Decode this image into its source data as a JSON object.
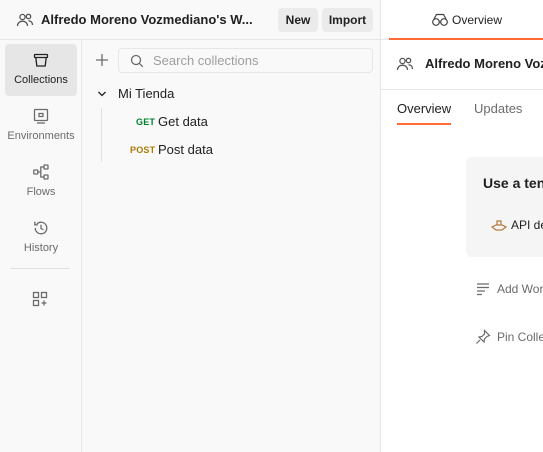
{
  "workspace": {
    "title": "Alfredo Moreno Vozmediano's W...",
    "new_label": "New",
    "import_label": "Import"
  },
  "sidebar": {
    "items": [
      {
        "label": "Collections",
        "icon": "collections-icon",
        "active": true
      },
      {
        "label": "Environments",
        "icon": "environments-icon",
        "active": false
      },
      {
        "label": "Flows",
        "icon": "flows-icon",
        "active": false
      },
      {
        "label": "History",
        "icon": "history-icon",
        "active": false
      }
    ],
    "extra_icon": "configure-sidebar-icon"
  },
  "collections": {
    "search_placeholder": "Search collections",
    "search_value": "",
    "tree": {
      "name": "Mi Tienda",
      "expanded": true,
      "requests": [
        {
          "method": "GET",
          "name": "Get data",
          "method_color": "#007f31"
        },
        {
          "method": "POST",
          "name": "Post data",
          "method_color": "#ad7a03"
        }
      ]
    }
  },
  "right": {
    "top_tab_label": "Overview",
    "workspace_title": "Alfredo Moreno Vozr",
    "tabs": [
      {
        "label": "Overview",
        "active": true
      },
      {
        "label": "Updates",
        "active": false
      }
    ],
    "card": {
      "title": "Use a ten",
      "item_label": "API de"
    },
    "actions": [
      {
        "label": "Add Wor",
        "icon": "description-icon"
      },
      {
        "label": "Pin Colle",
        "icon": "pin-icon"
      }
    ]
  },
  "colors": {
    "accent": "#ff6c37",
    "sidebar_bg": "#f9f9f9",
    "active_item_bg": "#e6e6e6"
  }
}
